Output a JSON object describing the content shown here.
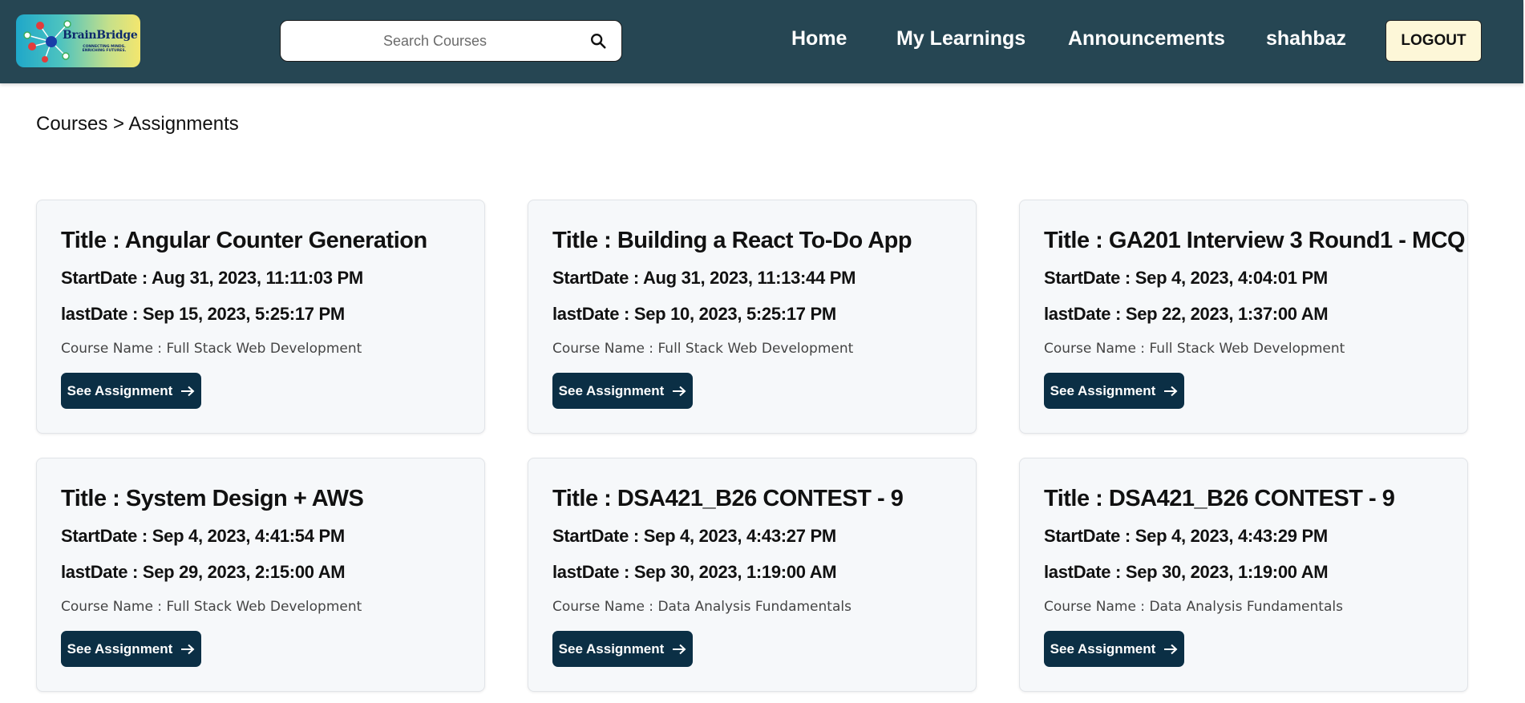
{
  "header": {
    "logo": {
      "title": "BrainBridge",
      "tagline": "CONNECTING MINDS. ENRICHING FUTURES."
    },
    "search": {
      "placeholder": "Search Courses",
      "value": ""
    },
    "nav": [
      {
        "label": "Home"
      },
      {
        "label": "My Learnings"
      },
      {
        "label": "Announcements"
      },
      {
        "label": "shahbaz"
      }
    ],
    "logout_label": "LOGOUT"
  },
  "breadcrumb": "Courses > Assignments",
  "assignments": [
    {
      "title": "Title : Angular Counter Generation",
      "start": "StartDate : Aug 31, 2023, 11:11:03 PM",
      "last": "lastDate : Sep 15, 2023, 5:25:17 PM",
      "course": "Course Name : Full Stack Web Development",
      "button": "See Assignment"
    },
    {
      "title": "Title : Building a React To-Do App",
      "start": "StartDate : Aug 31, 2023, 11:13:44 PM",
      "last": "lastDate : Sep 10, 2023, 5:25:17 PM",
      "course": "Course Name : Full Stack Web Development",
      "button": "See Assignment"
    },
    {
      "title": "Title : GA201 Interview 3 Round1 - MCQ",
      "start": "StartDate : Sep 4, 2023, 4:04:01 PM",
      "last": "lastDate : Sep 22, 2023, 1:37:00 AM",
      "course": "Course Name : Full Stack Web Development",
      "button": "See Assignment"
    },
    {
      "title": "Title : System Design + AWS",
      "start": "StartDate : Sep 4, 2023, 4:41:54 PM",
      "last": "lastDate : Sep 29, 2023, 2:15:00 AM",
      "course": "Course Name : Full Stack Web Development",
      "button": "See Assignment"
    },
    {
      "title": "Title : DSA421_B26 CONTEST - 9",
      "start": "StartDate : Sep 4, 2023, 4:43:27 PM",
      "last": "lastDate : Sep 30, 2023, 1:19:00 AM",
      "course": "Course Name : Data Analysis Fundamentals",
      "button": "See Assignment"
    },
    {
      "title": "Title : DSA421_B26 CONTEST - 9",
      "start": "StartDate : Sep 4, 2023, 4:43:29 PM",
      "last": "lastDate : Sep 30, 2023, 1:19:00 AM",
      "course": "Course Name : Data Analysis Fundamentals",
      "button": "See Assignment"
    }
  ],
  "colors": {
    "header_bg": "#264653",
    "button_bg": "#0b2f45",
    "logout_bg": "#fdf7d8",
    "card_bg": "#f6f8fa"
  },
  "icons": [
    "search-icon",
    "arrow-right-icon",
    "network-logo-icon"
  ]
}
